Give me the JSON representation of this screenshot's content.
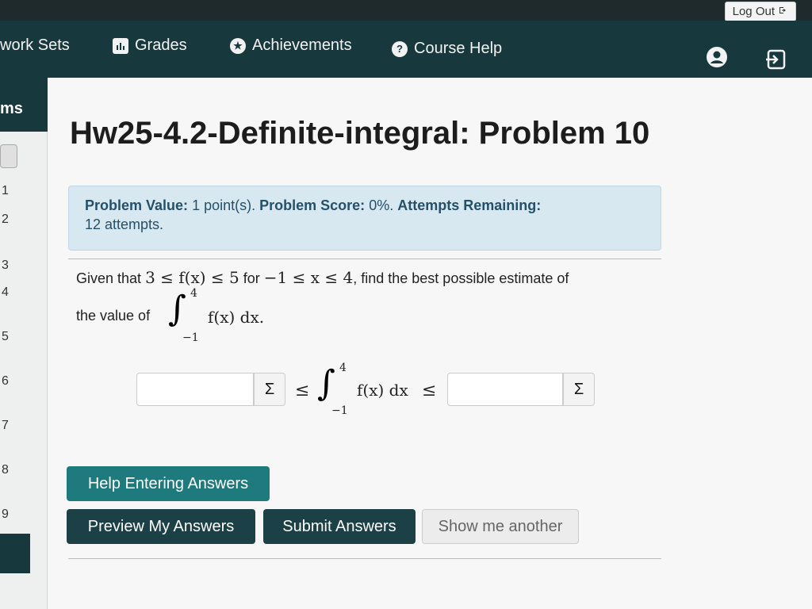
{
  "header": {
    "logout_label": "Log Out",
    "logout_icon": "sign-out-icon"
  },
  "nav": {
    "items": [
      {
        "label": "work Sets",
        "icon": ""
      },
      {
        "label": "Grades",
        "icon": "bar-chart-icon"
      },
      {
        "label": "Achievements",
        "icon": "star-icon"
      },
      {
        "label": "Course Help",
        "icon": "question-icon"
      }
    ],
    "user_icon": "user-icon",
    "exit_icon": "exit-icon"
  },
  "sidebar": {
    "header": "ms",
    "numbers": [
      "1",
      "2",
      "3",
      "4",
      "5",
      "6",
      "7",
      "8",
      "9"
    ]
  },
  "page": {
    "title": "Hw25-4.2-Definite-integral: Problem 10"
  },
  "problem_info": {
    "value_label": "Problem Value:",
    "value_text": "1 point(s).",
    "score_label": "Problem Score:",
    "score_text": "0%.",
    "attempts_label": "Attempts Remaining:",
    "attempts_text": "12 attempts."
  },
  "problem": {
    "line1_prefix": "Given that",
    "line1_ineq1": "3 ≤ f(x) ≤ 5",
    "line1_for": "for",
    "line1_ineq2": "−1 ≤ x ≤ 4",
    "line1_suffix": ", find the best possible estimate of",
    "line2_prefix": "the value of",
    "integrand": "f(x) dx.",
    "upper_limit": "4",
    "lower_limit": "−1"
  },
  "answer_row": {
    "lower_value": "",
    "upper_value": "",
    "leq": "≤",
    "integrand": "f(x) dx",
    "upper_limit": "4",
    "lower_limit": "−1",
    "sigma": "Σ"
  },
  "buttons": {
    "help": "Help Entering Answers",
    "preview": "Preview My Answers",
    "submit": "Submit Answers",
    "another": "Show me another"
  }
}
